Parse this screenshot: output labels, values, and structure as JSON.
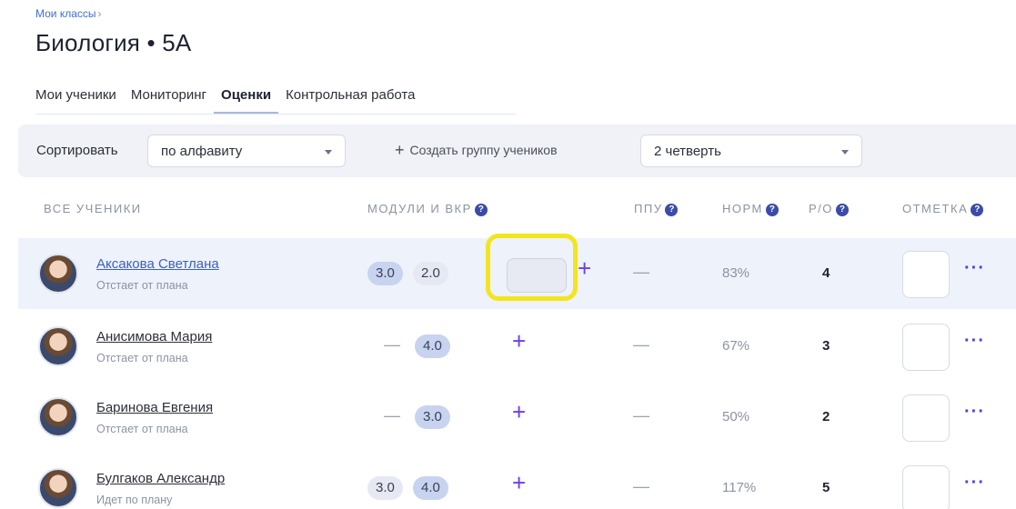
{
  "breadcrumb": {
    "label": "Мои классы",
    "separator": "›"
  },
  "page_title": "Биология • 5А",
  "tabs": [
    {
      "label": "Мои ученики",
      "active": false
    },
    {
      "label": "Мониторинг",
      "active": false
    },
    {
      "label": "Оценки",
      "active": true
    },
    {
      "label": "Контрольная работа",
      "active": false
    }
  ],
  "toolbar": {
    "sort_label": "Сортировать",
    "sort_value": "по алфавиту",
    "create_group_label": "Создать группу учеников",
    "quarter_value": "2 четверть"
  },
  "columns": {
    "students": "ВСЕ УЧЕНИКИ",
    "modules": "МОДУЛИ И ВКР",
    "ppu": "ППУ",
    "norm": "НОРМ",
    "ro": "Р/О",
    "mark": "ОТМЕТКА",
    "help_glyph": "?"
  },
  "students": [
    {
      "name": "Аксакова Светлана",
      "status": "Отстает от плана",
      "m1": "3.0",
      "m2": "2.0",
      "ppu": "—",
      "norm": "83%",
      "ro": "4",
      "more": "···"
    },
    {
      "name": "Анисимова Мария",
      "status": "Отстает от плана",
      "m1": "—",
      "m2": "4.0",
      "ppu": "—",
      "norm": "67%",
      "ro": "3",
      "more": "···"
    },
    {
      "name": "Баринова Евгения",
      "status": "Отстает от плана",
      "m1": "—",
      "m2": "3.0",
      "ppu": "—",
      "norm": "50%",
      "ro": "2",
      "more": "···"
    },
    {
      "name": "Булгаков Александр",
      "status": "Идет по плану",
      "m1": "3.0",
      "m2": "4.0",
      "ppu": "—",
      "norm": "117%",
      "ro": "5",
      "more": "···"
    }
  ],
  "add_glyph": "+",
  "colors": {
    "accent": "#6a3df0",
    "highlight": "#f3e51c",
    "link": "#3d5fc4",
    "row_highlight": "#eef2fb"
  }
}
